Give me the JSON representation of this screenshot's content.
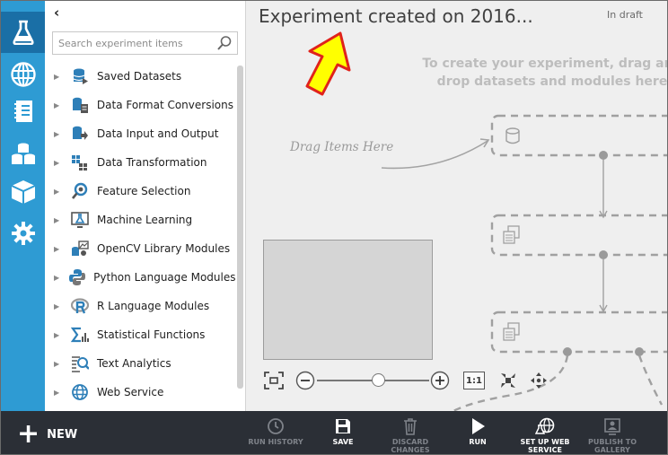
{
  "sidebar_rail": {
    "items": [
      {
        "icon": "flask-icon",
        "active": true
      },
      {
        "icon": "globe-icon"
      },
      {
        "icon": "notebook-icon"
      },
      {
        "icon": "datasets-icon"
      },
      {
        "icon": "cube-icon"
      },
      {
        "icon": "gear-icon"
      }
    ]
  },
  "palette": {
    "collapse_glyph": "‹",
    "search": {
      "placeholder": "Search experiment items",
      "value": ""
    },
    "items": [
      {
        "label": "Saved Datasets",
        "icon": "saved-datasets-icon"
      },
      {
        "label": "Data Format Conversions",
        "icon": "data-format-icon"
      },
      {
        "label": "Data Input and Output",
        "icon": "data-io-icon"
      },
      {
        "label": "Data Transformation",
        "icon": "data-transformation-icon"
      },
      {
        "label": "Feature Selection",
        "icon": "feature-selection-icon"
      },
      {
        "label": "Machine Learning",
        "icon": "machine-learning-icon"
      },
      {
        "label": "OpenCV Library Modules",
        "icon": "opencv-icon"
      },
      {
        "label": "Python Language Modules",
        "icon": "python-icon"
      },
      {
        "label": "R Language Modules",
        "icon": "r-language-icon"
      },
      {
        "label": "Statistical Functions",
        "icon": "statistical-functions-icon"
      },
      {
        "label": "Text Analytics",
        "icon": "text-analytics-icon"
      },
      {
        "label": "Web Service",
        "icon": "web-service-icon"
      }
    ]
  },
  "canvas": {
    "title": "Experiment created on 2016...",
    "status": "In draft",
    "hint": "To create your experiment, drag and drop datasets and modules here",
    "drag_label": "Drag Items Here",
    "zoom_one_to_one": "1:1",
    "zoom_level": 0.55
  },
  "command_bar": {
    "new_label": "NEW",
    "actions": [
      {
        "label": "RUN HISTORY",
        "icon": "clock-icon",
        "enabled": false
      },
      {
        "label": "SAVE",
        "icon": "save-icon",
        "enabled": true
      },
      {
        "label": "DISCARD\nCHANGES",
        "icon": "trash-icon",
        "enabled": false
      },
      {
        "label": "RUN",
        "icon": "play-icon",
        "enabled": true
      },
      {
        "label": "SET UP WEB\nSERVICE",
        "icon": "web-service-setup-icon",
        "enabled": true
      },
      {
        "label": "PUBLISH TO\nGALLERY",
        "icon": "publish-gallery-icon",
        "enabled": false
      }
    ]
  },
  "colors": {
    "rail": "#2e9bd3",
    "rail_active": "#1a6fa6",
    "arrow_fill": "#ffff00",
    "arrow_stroke": "#e0221b",
    "command_bar": "#2b2f36"
  }
}
